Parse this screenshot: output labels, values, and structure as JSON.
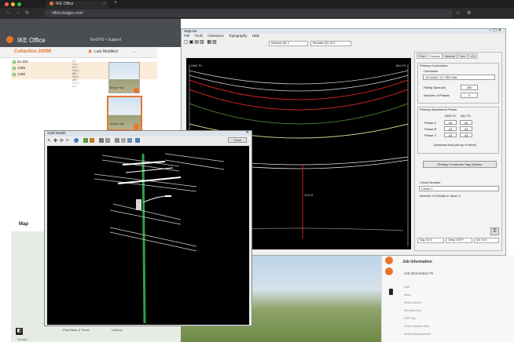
{
  "browser": {
    "tab_title": "IKE Office",
    "url": "office.ikegps.com/"
  },
  "app": {
    "brand": "IKE Office",
    "support_link": "IkeGPS • Support",
    "collection": "Collection 20099",
    "sort_label": "Last Modified",
    "items": [
      {
        "name": "No title",
        "date": "03 May, 2017 10:19 pm"
      },
      {
        "name": "1396",
        "date": "03 May, 2017 10:19 pm"
      },
      {
        "name": "1396",
        "date": "03 May, 2017 10:19 pm"
      }
    ],
    "thumb_labels": [
      "Bridge Hwy",
      "Bridge Hwy"
    ],
    "map_tab": "Map",
    "map_text": [
      "Pool Bank & Trend",
      "Lexicon",
      "Google"
    ]
  },
  "right_panel": {
    "section_title": "Job Information",
    "job_title": "Job Information #1",
    "fields": [
      "Date",
      "Notes",
      "Field Collector",
      "Electrical Rep",
      "OSP Rep",
      "Field Collection Date",
      "Verified Measurement"
    ]
  },
  "sagline": {
    "title": "SagLine",
    "menu": [
      "File",
      "Tools",
      "Clearance",
      "Topography",
      "Help"
    ],
    "distance": "Distance (ft): 0",
    "elevation": "Elevation (ft): 42.2",
    "left_label": "ANG PL",
    "right_label": "ADJ PL",
    "mid_value": "13.6 ft",
    "tabs": [
      "Pole",
      "Primary",
      "Neutral",
      "Sec",
      "LOJ"
    ],
    "primary_conductors": {
      "legend": "Primary Conductors",
      "conductor_label": "Conductor",
      "conductor_value": "1/0 AAAC (7) TBD HAL",
      "ruling_span_label": "Ruling Span (ft)",
      "ruling_span_value": "250",
      "phases_label": "Number of Phases",
      "phases_value": "3"
    },
    "attachment_points": {
      "legend": "Primary Attachment Points",
      "col_left": "ANG PL",
      "col_right": "ADJ PL",
      "rows": [
        {
          "label": "Phase A",
          "left": "43",
          "right": "43"
        },
        {
          "label": "Phase B",
          "left": "43",
          "right": "43"
        },
        {
          "label": "Phase C",
          "left": "43",
          "right": "43"
        }
      ],
      "note": "(measured from pole top in inches)"
    },
    "options_button": "Primary Conductor Sag Options",
    "circuit_label": "Circuit Number",
    "circuit_value": "Circuit 1",
    "circuits_in_span": "Number of Circuits in Span: 2",
    "status": [
      "Sag: 92 in",
      "Temp: 200°F",
      "Ice: 0.00"
    ]
  },
  "solid_model": {
    "title": "Solid Model",
    "close_label": "Close"
  },
  "colors": {
    "accent": "#e8752a",
    "pole_green": "#2ea043",
    "conductor_red": "#cc2222",
    "canvas_bg": "#000000"
  }
}
